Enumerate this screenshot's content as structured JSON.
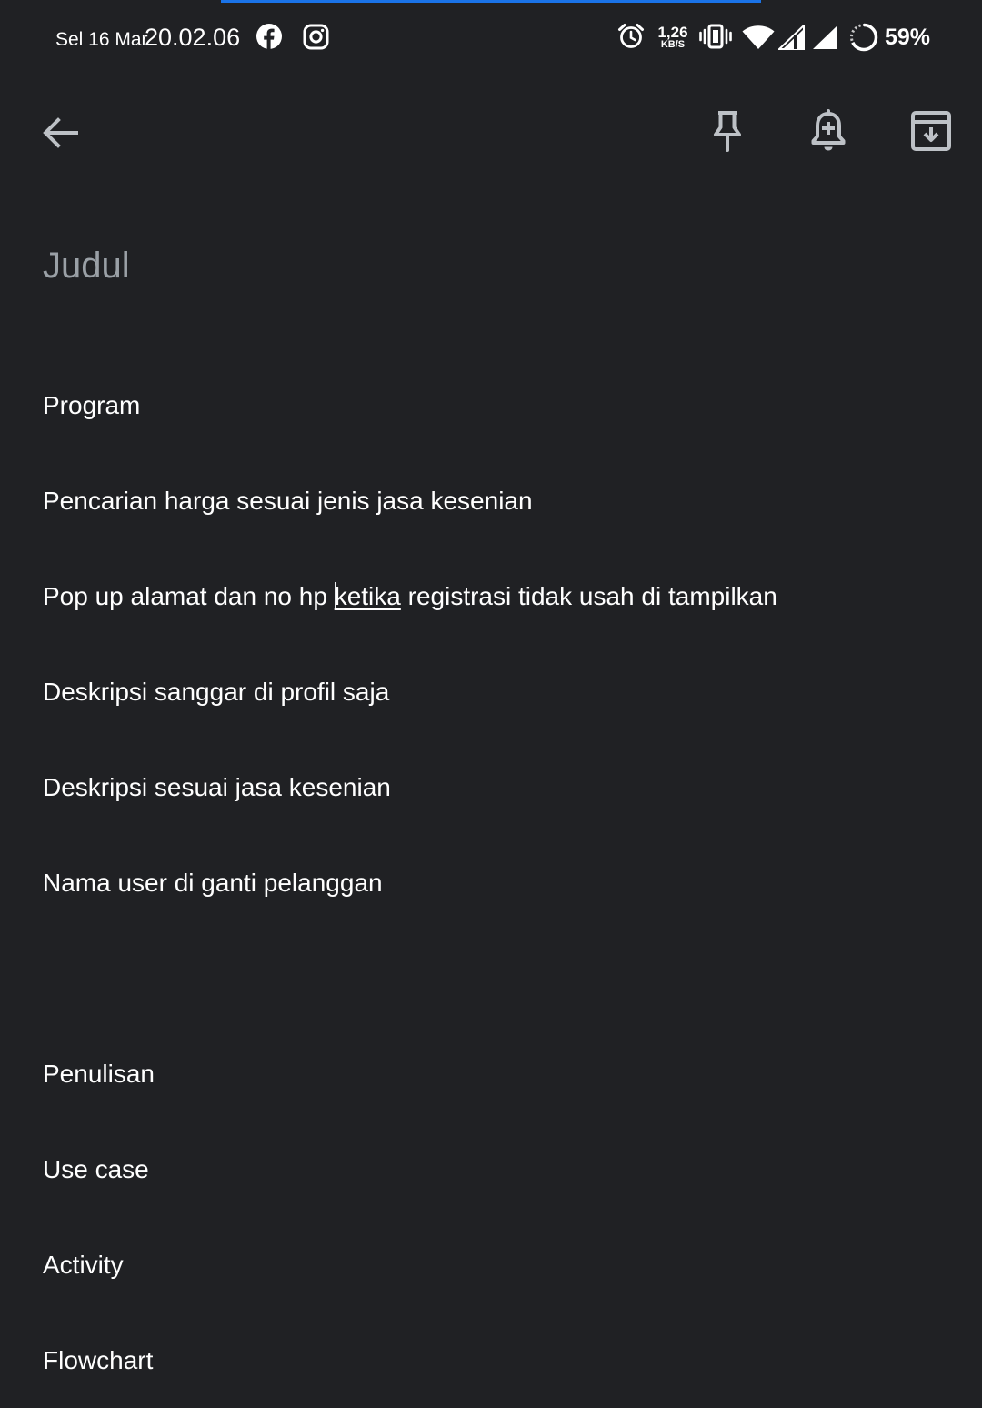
{
  "status_bar": {
    "date": "Sel 16 Mar",
    "time": "20.02.06",
    "net_speed_value": "1,26",
    "net_speed_unit": "KB/S",
    "battery_percent": "59%",
    "icons": [
      "facebook-icon",
      "instagram-icon",
      "alarm-icon",
      "vibrate-icon",
      "wifi-icon",
      "signal-icon",
      "signal-icon",
      "battery-ring-icon"
    ]
  },
  "toolbar": {
    "back_icon": "arrow-left-icon",
    "pin_icon": "pin-icon",
    "reminder_icon": "bell-plus-icon",
    "archive_icon": "archive-icon"
  },
  "note": {
    "title_placeholder": "Judul",
    "lines": {
      "l0": "Program",
      "l1": "Pencarian harga sesuai jenis jasa kesenian",
      "l2_before": "Pop up alamat dan no hp ",
      "l2_underlined": "ketika",
      "l2_after": " registrasi tidak usah di tampilkan",
      "l3": "Deskripsi sanggar di profil saja",
      "l4": "Deskripsi sesuai jasa kesenian",
      "l5": "Nama user di ganti pelanggan",
      "l7": "Penulisan",
      "l8": "Use case",
      "l9": "Activity",
      "l10": "Flowchart"
    }
  },
  "colors": {
    "background": "#202124",
    "text": "#ffffff",
    "placeholder": "#9aa0a6",
    "icon": "#bdc1c6",
    "accent": "#1a73e8"
  }
}
